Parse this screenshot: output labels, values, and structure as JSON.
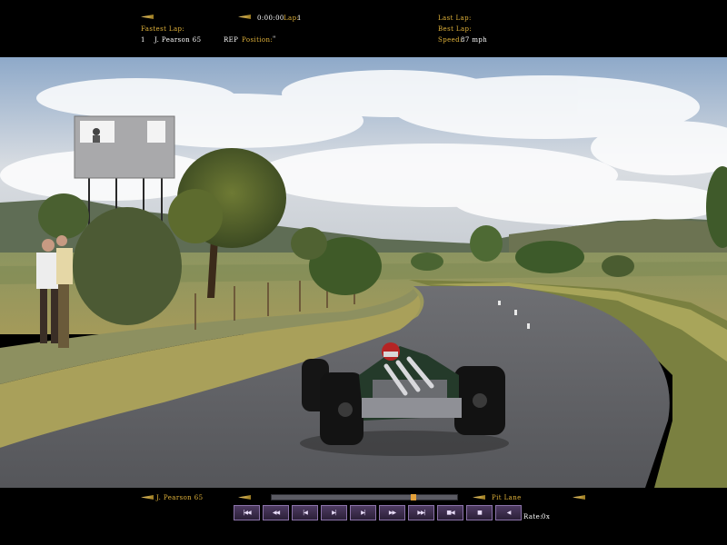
{
  "hud": {
    "lap_time": "0:00:00",
    "lap_label": "Lap:",
    "lap_value": "1",
    "fastest_lap_label": "Fastest Lap:",
    "fastest_lap_position": "1",
    "fastest_lap_driver": "J. Pearson 65",
    "fastest_lap_mode": "REP",
    "position_label": "Position:",
    "position_value": "\"",
    "last_lap_label": "Last Lap:",
    "best_lap_label": "Best Lap:",
    "speed_label": "Speed:",
    "speed_value": "87 mph"
  },
  "replay": {
    "driver": "J. Pearson 65",
    "camera": "Pit Lane",
    "rate_label": "Rate:",
    "rate_value": "0x",
    "progress": 0.75,
    "controls": [
      {
        "name": "skip-start",
        "glyph": "|◀◀"
      },
      {
        "name": "fast-rewind",
        "glyph": "◀◀"
      },
      {
        "name": "step-back",
        "glyph": "|◀"
      },
      {
        "name": "play-pause",
        "glyph": "▶|"
      },
      {
        "name": "step-forward",
        "glyph": "▶|"
      },
      {
        "name": "play",
        "glyph": "▶▶"
      },
      {
        "name": "fast-forward",
        "glyph": "▶▶|"
      },
      {
        "name": "skip-end",
        "glyph": "■◀"
      },
      {
        "name": "record",
        "glyph": "■"
      },
      {
        "name": "camera",
        "glyph": "◀"
      }
    ]
  },
  "colors": {
    "hud_label": "#e0b23a",
    "hud_value": "#ffffff",
    "button": "#3b2c4d",
    "progress_marker": "#e2a03a"
  }
}
